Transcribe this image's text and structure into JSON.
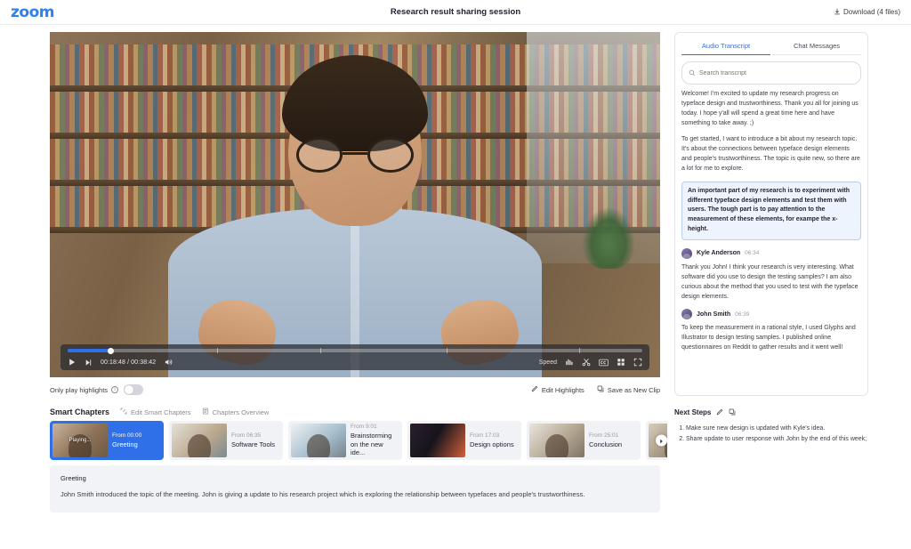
{
  "header": {
    "logo": "zoom",
    "title": "Research result sharing session",
    "download_label": "Download (4 files)",
    "download_icon": "download-icon"
  },
  "player": {
    "current_time": "00:18:48",
    "total_time": "00:38:42",
    "time_display": "00:18:48 / 00:38:42",
    "progress_percent": 7.5,
    "play_icon": "play-icon",
    "next_icon": "skip-next-icon",
    "volume_icon": "volume-icon",
    "speed_label": "Speed",
    "audio_levels_icon": "audio-levels-icon",
    "trim_icon": "scissors-icon",
    "cc_icon": "closed-caption-icon",
    "layout_icon": "grid-layout-icon",
    "fullscreen_icon": "fullscreen-icon"
  },
  "highlights": {
    "toggle_label": "Only play highlights",
    "info_icon": "info-icon",
    "toggle_state": "off",
    "edit_label": "Edit Highlights",
    "edit_icon": "pencil-icon",
    "save_label": "Save as New Clip",
    "save_icon": "save-clip-icon"
  },
  "chapters": {
    "title": "Smart Chapters",
    "edit_label": "Edit Smart Chapters",
    "edit_icon": "edit-chapters-icon",
    "overview_label": "Chapters Overview",
    "overview_icon": "list-overview-icon",
    "next_icon": "chevron-right-icon",
    "playing_label": "Playing...",
    "from_prefix": "From",
    "items": [
      {
        "from": "From 00:00",
        "name": "Greeting",
        "active": true
      },
      {
        "from": "From 06:35",
        "name": "Software Tools",
        "active": false
      },
      {
        "from": "From 9:01",
        "name": "Brainstorming on the new ide...",
        "active": false
      },
      {
        "from": "From 17:03",
        "name": "Design options",
        "active": false
      },
      {
        "from": "From 25:01",
        "name": "Conclusion",
        "active": false
      },
      {
        "from": "",
        "name": "",
        "active": false
      }
    ]
  },
  "summary": {
    "title": "Greeting",
    "text": "John Smith introduced the topic of the meeting. John is giving a  update to his research project which is exploring the relationship between typefaces and people's trustworthiness."
  },
  "transcript": {
    "tabs": [
      {
        "label": "Audio Transcript",
        "active": true
      },
      {
        "label": "Chat Messages",
        "active": false
      }
    ],
    "search_placeholder": "Search transcript",
    "search_value": "",
    "search_icon": "search-icon",
    "paragraphs": [
      {
        "type": "text",
        "text": "Welcome! I'm excited to update my research progress on typeface design and trustworthiness. Thank you all for joining us today. I hope y'all will spend a great time here and have something to take away. ;)"
      },
      {
        "type": "text",
        "text": "To get started, I want to introduce a bit about my research topic. It's about the connections between typeface design elements and people's trustworthiness. The topic is quite new, so there are a lot for me to explore."
      },
      {
        "type": "highlight",
        "text": "An important part of my research is to experiment with different typeface design elements and test them with users. The tough part is to pay attention to the measurement of these elements, for exampe the x-height."
      },
      {
        "type": "speaker",
        "name": "Kyle Anderson",
        "time": "06:34",
        "text": "Thank you John! I think your research is very interesting. What software did you use to design the testing samples? I am also curious about the method that you used to test with the typeface design elements."
      },
      {
        "type": "speaker",
        "name": "John Smith",
        "time": "06:39",
        "text": "To keep the measurement in a rational style, I used Glyphs and Illustrator to design testing samples. I published online questionnaires on Reddit to gather results and it went well!"
      }
    ]
  },
  "next_steps": {
    "title": "Next Steps",
    "edit_icon": "pencil-icon",
    "copy_icon": "copy-icon",
    "items": [
      "Make sure new design is updated with Kyle's idea.",
      "Share update to user response with John by the end of this week;"
    ]
  },
  "colors": {
    "accent": "#2f6fe8",
    "panel_bg": "#f1f3f7",
    "chip_bg": "#f1f2f6",
    "text": "#232333",
    "muted": "#8b8b96"
  }
}
